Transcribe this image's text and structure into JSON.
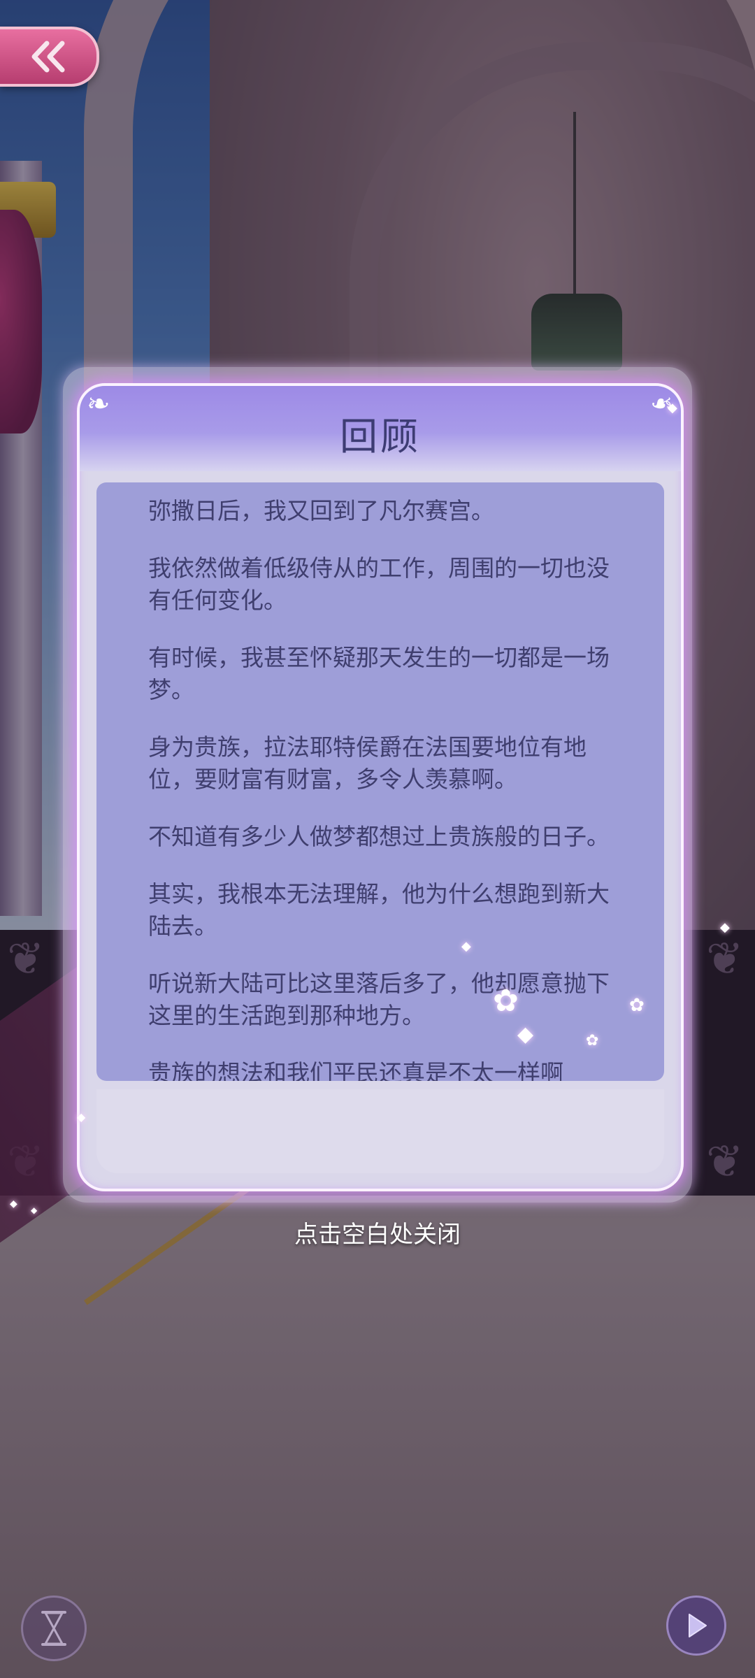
{
  "dialog": {
    "title": "回顾",
    "paragraphs": [
      "弥撒日后，我又回到了凡尔赛宫。",
      "我依然做着低级侍从的工作，周围的一切也没有任何变化。",
      "有时候，我甚至怀疑那天发生的一切都是一场梦。",
      "身为贵族，拉法耶特侯爵在法国要地位有地位，要财富有财富，多令人羡慕啊。",
      "不知道有多少人做梦都想过上贵族般的日子。",
      "其实，我根本无法理解，他为什么想跑到新大陆去。",
      "听说新大陆可比这里落后多了，他却愿意抛下这里的生活跑到那种地方。",
      "贵族的想法和我们平民还真是不太一样啊"
    ]
  },
  "close_hint": "点击空白处关闭",
  "controls": {
    "back_icon": "double-chevron-left-icon",
    "hourglass_icon": "hourglass-icon",
    "play_icon": "play-icon"
  },
  "colors": {
    "title_text": "#3d3c73",
    "panel_bg": "#9e9ed8",
    "body_text": "#3f3e6e",
    "back_button": "#d9568a"
  }
}
